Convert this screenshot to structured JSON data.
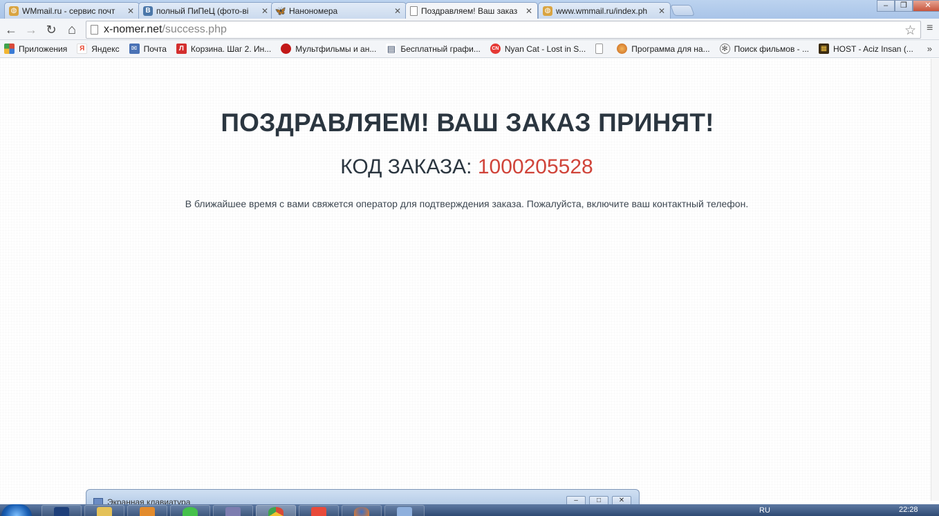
{
  "tabs": [
    {
      "title": "WMmail.ru - сервис почт",
      "favicon": "globe-icon",
      "color": "#d9a441"
    },
    {
      "title": "полный ПиПеЦ (фото-ві",
      "favicon": "vk-icon",
      "color": "#4b77a9",
      "glyph": "В"
    },
    {
      "title": "Нанономера",
      "favicon": "butterfly-icon",
      "color": "#2f8ed8"
    },
    {
      "title": "Поздравляем! Ваш заказ",
      "favicon": "page-icon",
      "color": "#ffffff",
      "active": true
    },
    {
      "title": "www.wmmail.ru/index.ph",
      "favicon": "globe-icon",
      "color": "#d9a441"
    }
  ],
  "window_controls": {
    "minimize": "–",
    "maximize": "❐",
    "close": "✕"
  },
  "toolbar": {
    "back": "←",
    "forward": "→",
    "reload": "↻",
    "home": "⌂",
    "url_host": "x-nomer.net",
    "url_path": "/success.php",
    "star": "☆",
    "menu": "≡"
  },
  "bookmarks": [
    {
      "label": "Приложения",
      "icon": "apps-icon",
      "color": "#d84a3a",
      "glyph": "⁝"
    },
    {
      "label": "Яндекс",
      "icon": "yandex-icon",
      "color": "#e8452f",
      "glyph": "Я"
    },
    {
      "label": "Почта",
      "icon": "mail-icon",
      "color": "#4a72b5",
      "glyph": "✉"
    },
    {
      "label": "Корзина. Шаг 2. Ин...",
      "icon": "l-logo-icon",
      "color": "#d32f2f",
      "glyph": "Л"
    },
    {
      "label": "Мультфильмы и ан...",
      "icon": "red-ball-icon",
      "color": "#c21818",
      "glyph": "●"
    },
    {
      "label": "Бесплатный графи...",
      "icon": "chart-icon",
      "color": "#3a4a66",
      "glyph": "▤"
    },
    {
      "label": "Nyan Cat - Lost in S...",
      "icon": "cn-icon",
      "color": "#e53935",
      "glyph": "CN"
    },
    {
      "label": "",
      "icon": "page-icon",
      "color": "#ffffff",
      "glyph": ""
    },
    {
      "label": "Программа для на...",
      "icon": "orange-circle-icon",
      "color": "#d9822b",
      "glyph": "●"
    },
    {
      "label": "Поиск фильмов - ...",
      "icon": "film-reel-icon",
      "color": "#666666",
      "glyph": "✻"
    },
    {
      "label": "HOST - Aciz Insan (...",
      "icon": "host-icon",
      "color": "#3a2a10",
      "glyph": "▦"
    }
  ],
  "bookmarks_more": "»",
  "page": {
    "headline": "ПОЗДРАВЛЯЕМ! ВАШ ЗАКАЗ ПРИНЯТ!",
    "order_label": "КОД ЗАКАЗА:",
    "order_code": "1000205528",
    "note": "В ближайшее время с вами свяжется оператор для подтверждения заказа. Пожалуйста, включите ваш контактный телефон.",
    "code_color": "#d0443a"
  },
  "osk": {
    "title": "Экранная клавиатура",
    "min": "–",
    "max": "□",
    "close": "✕"
  },
  "taskbar": {
    "apps": [
      {
        "icon": "photoshop-icon",
        "color": "#1e3f7a"
      },
      {
        "icon": "folder-icon",
        "color": "#e4c158"
      },
      {
        "icon": "media-player-icon",
        "color": "#e38b2c"
      },
      {
        "icon": "icq-icon",
        "color": "#45c04b"
      },
      {
        "icon": "winamp-icon",
        "color": "#7d7db0"
      },
      {
        "icon": "chrome-icon",
        "color": "#d94a38"
      },
      {
        "icon": "yandex-browser-icon",
        "color": "#e84a3a"
      },
      {
        "icon": "firefox-icon",
        "color": "#e0772a"
      },
      {
        "icon": "keyboard-icon",
        "color": "#8fb0dd"
      }
    ],
    "lang": "RU",
    "clock": "22:28"
  }
}
